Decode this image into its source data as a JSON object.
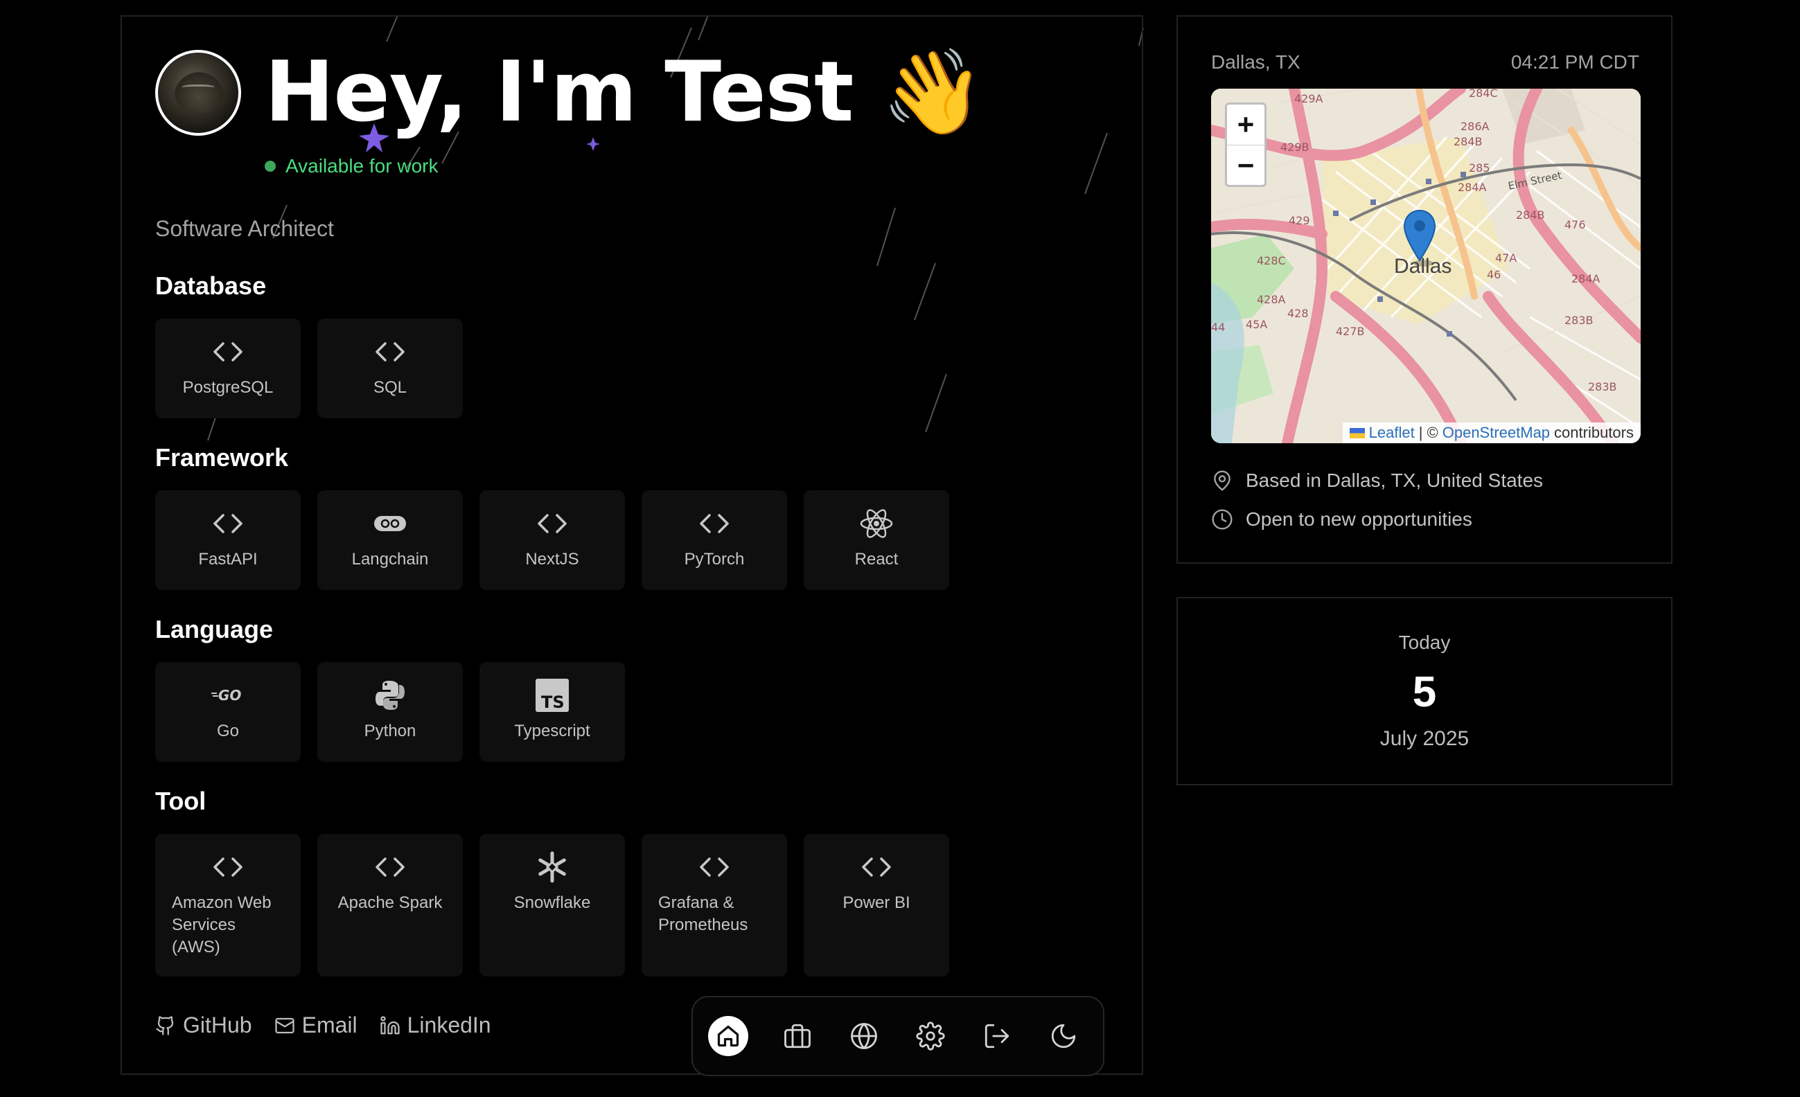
{
  "profile": {
    "greeting": "Hey, I'm Test 👋",
    "status": "Available for work",
    "role": "Software Architect"
  },
  "sections": [
    {
      "title": "Database",
      "items": [
        {
          "name": "PostgreSQL",
          "icon": "code-icon"
        },
        {
          "name": "SQL",
          "icon": "code-icon"
        }
      ]
    },
    {
      "title": "Framework",
      "items": [
        {
          "name": "FastAPI",
          "icon": "code-icon"
        },
        {
          "name": "Langchain",
          "icon": "langchain-icon"
        },
        {
          "name": "NextJS",
          "icon": "code-icon"
        },
        {
          "name": "PyTorch",
          "icon": "code-icon"
        },
        {
          "name": "React",
          "icon": "react-icon"
        }
      ]
    },
    {
      "title": "Language",
      "items": [
        {
          "name": "Go",
          "icon": "go-icon"
        },
        {
          "name": "Python",
          "icon": "python-icon"
        },
        {
          "name": "Typescript",
          "icon": "typescript-icon"
        }
      ]
    },
    {
      "title": "Tool",
      "items": [
        {
          "name": "Amazon Web Services (AWS)",
          "icon": "code-icon"
        },
        {
          "name": "Apache Spark",
          "icon": "code-icon"
        },
        {
          "name": "Snowflake",
          "icon": "snowflake-icon"
        },
        {
          "name": "Grafana & Prometheus",
          "icon": "code-icon"
        },
        {
          "name": "Power BI",
          "icon": "code-icon"
        }
      ]
    }
  ],
  "links": {
    "github": "GitHub",
    "email": "Email",
    "linkedin": "LinkedIn"
  },
  "dock": [
    "home-icon",
    "briefcase-icon",
    "globe-icon",
    "settings-icon",
    "logout-icon",
    "moon-icon"
  ],
  "location": {
    "city": "Dallas, TX",
    "time": "04:21 PM CDT",
    "map": {
      "zoom_in": "+",
      "zoom_out": "−",
      "city_label": "Dallas",
      "attribution_leaflet": "Leaflet",
      "attribution_sep": "| ©",
      "attribution_osm": "OpenStreetMap",
      "attribution_suffix": "contributors"
    },
    "based_in": "Based in Dallas, TX, United States",
    "open_to": "Open to new opportunities"
  },
  "date": {
    "label": "Today",
    "day": "5",
    "month_year": "July 2025"
  },
  "colors": {
    "accent_green": "#4ade80",
    "background": "#000000"
  }
}
